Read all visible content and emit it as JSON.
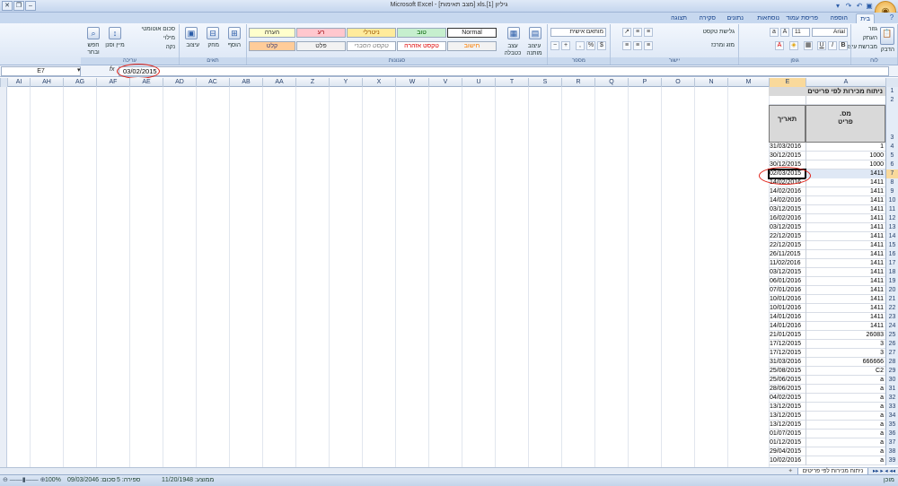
{
  "title": "Microsoft Excel - [מצב תאימות] xls.[1] גיליון",
  "tabs": [
    "בית",
    "הוספה",
    "פריסת עמוד",
    "נוסחאות",
    "נתונים",
    "סקירה",
    "תצוגה"
  ],
  "clipboard": {
    "paste": "הדבק",
    "cut": "גזור",
    "copy": "העתק",
    "format_painter": "מברשת עיצוב",
    "label": "לוח"
  },
  "font": {
    "name": "Arial",
    "size": "11",
    "label": "גופן"
  },
  "alignment": {
    "wrap": "גלישת טקסט",
    "merge": "מזג ומרכז",
    "label": "יישור"
  },
  "number": {
    "format": "מותאם אישית",
    "label": "מספר"
  },
  "styles": {
    "cond": "עיצוב מותנה",
    "table": "עצב כטבלה",
    "label": "סגנונות",
    "normal": "Normal",
    "good": "טוב",
    "neutral": "ניטרלי",
    "bad": "רע",
    "note": "הערה",
    "calc": "חישוב",
    "warn": "טקסט אזהרה",
    "explan": "טקסט הסברי",
    "input": "קלט",
    "output": "פלט"
  },
  "cells": {
    "insert": "הוסף",
    "delete": "מחק",
    "format": "עיצוב",
    "label": "תאים"
  },
  "editing": {
    "autosum": "סכום אוטומטי",
    "fill": "מילוי",
    "clear": "נקה",
    "sort": "מיין וסנן",
    "find": "חפש ובחר",
    "label": "עריכה"
  },
  "namebox": "E7",
  "formula": "03/02/2015",
  "columns": [
    "A",
    "E",
    "M",
    "N",
    "O",
    "P",
    "Q",
    "R",
    "S",
    "T",
    "U",
    "V",
    "W",
    "X",
    "Y",
    "Z",
    "AA",
    "AB",
    "AC",
    "AD",
    "AE",
    "AF",
    "AG",
    "AH",
    "AI"
  ],
  "sheet_title": "ניתוח מכירות לפי פריטים",
  "header_A": "מס. פריט",
  "header_E": "תאריך",
  "rows": [
    {
      "r": "1",
      "a": "",
      "e": ""
    },
    {
      "r": "2",
      "a": "",
      "e": ""
    },
    {
      "r": "3",
      "a": "",
      "e": ""
    },
    {
      "r": "4",
      "a": "1",
      "e": "31/03/2016"
    },
    {
      "r": "5",
      "a": "1000",
      "e": "30/12/2015"
    },
    {
      "r": "6",
      "a": "1000",
      "e": "30/12/2015"
    },
    {
      "r": "7",
      "a": "1411",
      "e": "02/03/2015"
    },
    {
      "r": "8",
      "a": "1411",
      "e": "14/02/2016"
    },
    {
      "r": "9",
      "a": "1411",
      "e": "14/02/2016"
    },
    {
      "r": "10",
      "a": "1411",
      "e": "14/02/2016"
    },
    {
      "r": "11",
      "a": "1411",
      "e": "03/12/2015"
    },
    {
      "r": "12",
      "a": "1411",
      "e": "16/02/2016"
    },
    {
      "r": "13",
      "a": "1411",
      "e": "03/12/2015"
    },
    {
      "r": "14",
      "a": "1411",
      "e": "22/12/2015"
    },
    {
      "r": "15",
      "a": "1411",
      "e": "22/12/2015"
    },
    {
      "r": "16",
      "a": "1411",
      "e": "26/11/2015"
    },
    {
      "r": "17",
      "a": "1411",
      "e": "11/02/2016"
    },
    {
      "r": "18",
      "a": "1411",
      "e": "03/12/2015"
    },
    {
      "r": "19",
      "a": "1411",
      "e": "06/01/2016"
    },
    {
      "r": "20",
      "a": "1411",
      "e": "07/01/2016"
    },
    {
      "r": "21",
      "a": "1411",
      "e": "10/01/2016"
    },
    {
      "r": "22",
      "a": "1411",
      "e": "10/01/2016"
    },
    {
      "r": "23",
      "a": "1411",
      "e": "14/01/2016"
    },
    {
      "r": "24",
      "a": "1411",
      "e": "14/01/2016"
    },
    {
      "r": "25",
      "a": "26083",
      "e": "21/01/2015"
    },
    {
      "r": "26",
      "a": "3",
      "e": "17/12/2015"
    },
    {
      "r": "27",
      "a": "3",
      "e": "17/12/2015"
    },
    {
      "r": "28",
      "a": "666666",
      "e": "31/03/2016"
    },
    {
      "r": "29",
      "a": "C2",
      "e": "25/08/2015"
    },
    {
      "r": "30",
      "a": "a",
      "e": "25/06/2015"
    },
    {
      "r": "31",
      "a": "a",
      "e": "28/06/2015"
    },
    {
      "r": "32",
      "a": "a",
      "e": "04/02/2015"
    },
    {
      "r": "33",
      "a": "a",
      "e": "13/12/2015"
    },
    {
      "r": "34",
      "a": "a",
      "e": "13/12/2015"
    },
    {
      "r": "35",
      "a": "a",
      "e": "13/12/2015"
    },
    {
      "r": "36",
      "a": "a",
      "e": "01/07/2015"
    },
    {
      "r": "37",
      "a": "a",
      "e": "01/12/2015"
    },
    {
      "r": "38",
      "a": "a",
      "e": "29/04/2015"
    },
    {
      "r": "39",
      "a": "a",
      "e": "10/02/2016"
    }
  ],
  "sheet_tab": "ניתוח מכירות לפי פריטים",
  "status": {
    "ready": "מוכן",
    "average": "ממוצע: 11/20/1948",
    "count": "ספירה: 5",
    "sum": "סכום: 09/03/2046",
    "zoom": "100%"
  }
}
